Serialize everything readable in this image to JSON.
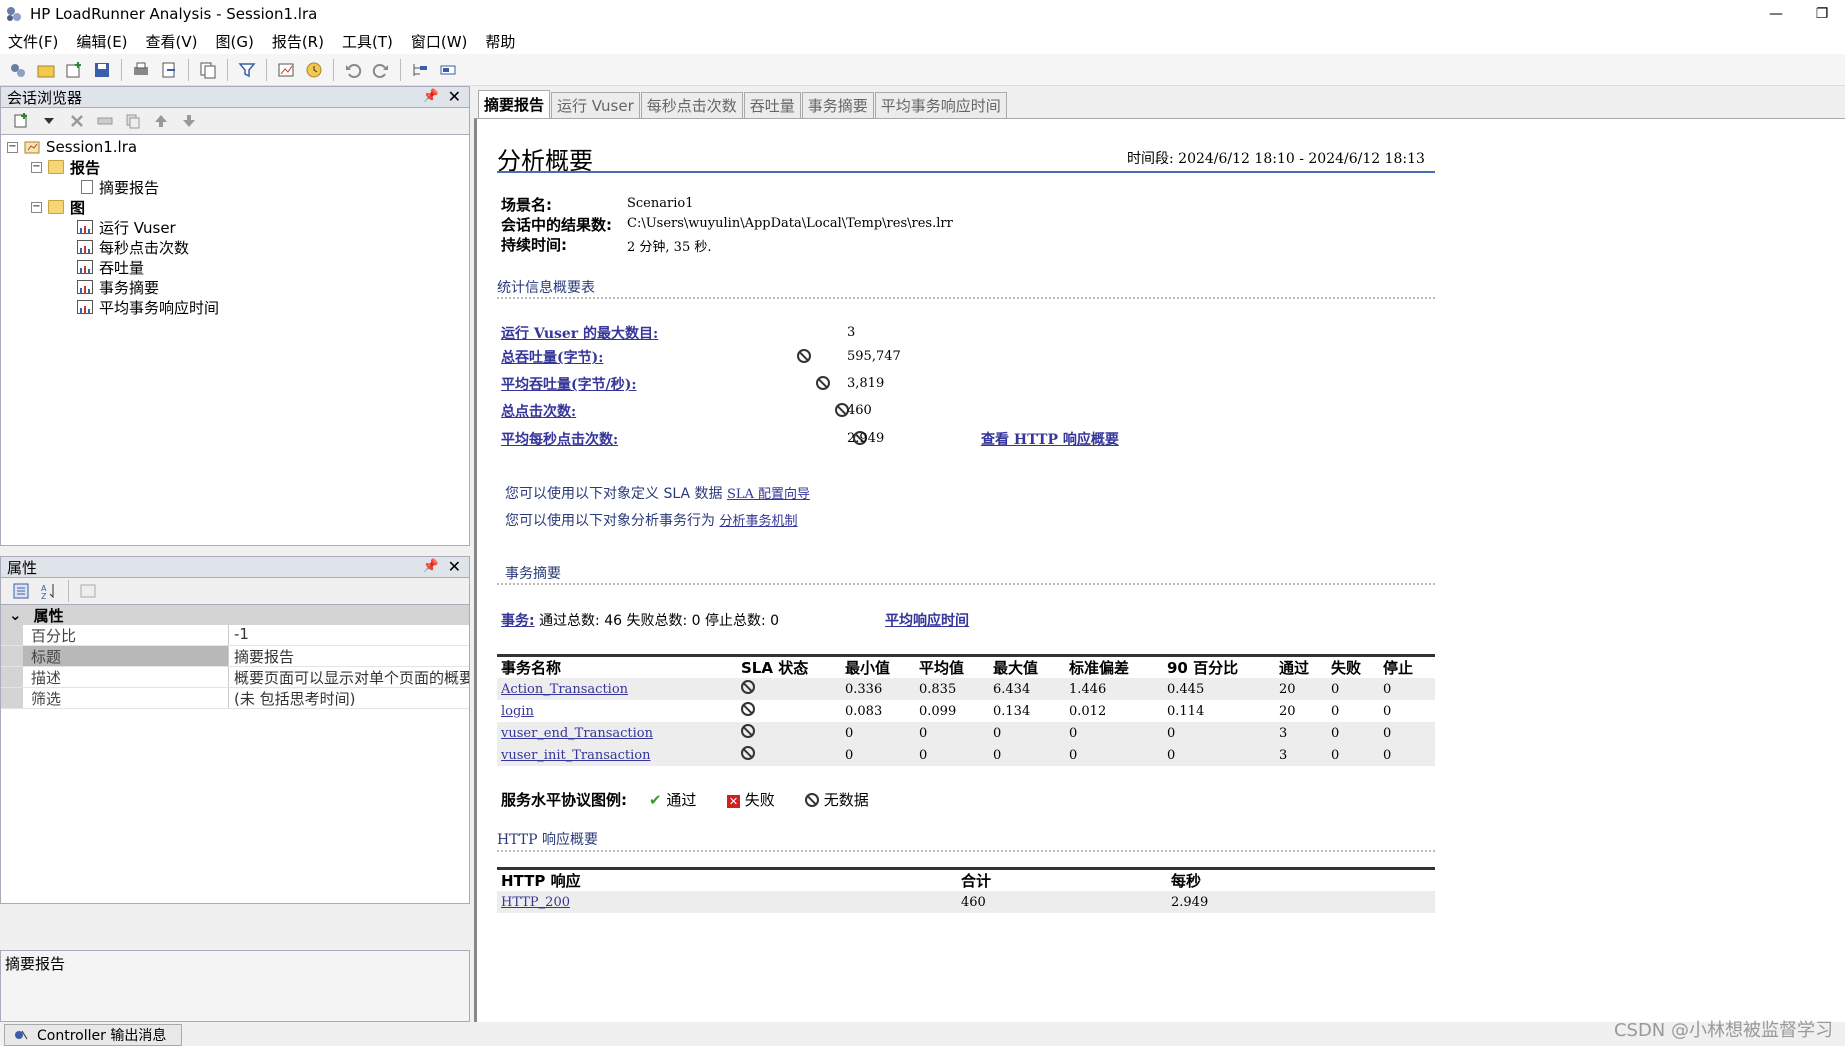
{
  "window": {
    "title": "HP LoadRunner Analysis - Session1.lra"
  },
  "menu": [
    "文件(F)",
    "编辑(E)",
    "查看(V)",
    "图(G)",
    "报告(R)",
    "工具(T)",
    "窗口(W)",
    "帮助"
  ],
  "session_browser": {
    "title": "会话浏览器",
    "tree": {
      "root": "Session1.lra",
      "report_folder": "报告",
      "report_items": [
        "摘要报告"
      ],
      "graph_folder": "图",
      "graph_items": [
        "运行 Vuser",
        "每秒点击次数",
        "吞吐量",
        "事务摘要",
        "平均事务响应时间"
      ]
    }
  },
  "properties": {
    "title": "属性",
    "category": "属性",
    "rows": [
      {
        "key": "百分比",
        "value": "-1"
      },
      {
        "key": "标题",
        "value": "摘要报告"
      },
      {
        "key": "描述",
        "value": "概要页面可以显示对单个页面的概要"
      },
      {
        "key": "筛选",
        "value": "(未 包括思考时间)"
      }
    ],
    "description": "摘要报告"
  },
  "status": {
    "output_tab": "Controller 输出消息"
  },
  "tabs": [
    "摘要报告",
    "运行 Vuser",
    "每秒点击次数",
    "吞吐量",
    "事务摘要",
    "平均事务响应时间"
  ],
  "report": {
    "heading": "分析概要",
    "period_label": "时间段:",
    "period_value": "2024/6/12 18:10 - 2024/6/12 18:13",
    "scenario_label": "场景名:",
    "scenario_value": "Scenario1",
    "results_label": "会话中的结果数:",
    "results_value": "C:\\Users\\wuyulin\\AppData\\Local\\Temp\\res\\res.lrr",
    "duration_label": "持续时间:",
    "duration_value": "2 分钟, 35 秒.",
    "stats_title": "统计信息概要表",
    "stats": [
      {
        "label": "运行 Vuser 的最大数目:",
        "value": "3",
        "icon": false
      },
      {
        "label": "总吞吐量(字节):",
        "value": "595,747",
        "icon": true
      },
      {
        "label": "平均吞吐量(字节/秒):",
        "value": "3,819",
        "icon": true
      },
      {
        "label": "总点击次数:",
        "value": "460",
        "icon": true
      },
      {
        "label": "平均每秒点击次数:",
        "value": "2.949",
        "icon": true
      }
    ],
    "http_summary_link": "查看 HTTP 响应概要",
    "sla_text": "您可以使用以下对象定义 SLA 数据",
    "sla_link": "SLA 配置向导",
    "analyze_text": "您可以使用以下对象分析事务行为",
    "analyze_link": "分析事务机制",
    "trans_title": "事务摘要",
    "trans_label": "事务:",
    "trans_counts": "通过总数: 46 失败总数: 0 停止总数: 0",
    "avg_resp_link": "平均响应时间",
    "trans_headers": [
      "事务名称",
      "SLA 状态",
      "最小值",
      "平均值",
      "最大值",
      "标准偏差",
      "90 百分比",
      "通过",
      "失败",
      "停止"
    ],
    "trans_rows": [
      [
        "Action_Transaction",
        "",
        "0.336",
        "0.835",
        "6.434",
        "1.446",
        "0.445",
        "20",
        "0",
        "0"
      ],
      [
        "login",
        "",
        "0.083",
        "0.099",
        "0.134",
        "0.012",
        "0.114",
        "20",
        "0",
        "0"
      ],
      [
        "vuser_end_Transaction",
        "",
        "0",
        "0",
        "0",
        "0",
        "0",
        "3",
        "0",
        "0"
      ],
      [
        "vuser_init_Transaction",
        "",
        "0",
        "0",
        "0",
        "0",
        "0",
        "3",
        "0",
        "0"
      ]
    ],
    "legend_label": "服务水平协议图例:",
    "legend_pass": "通过",
    "legend_fail": "失败",
    "legend_nodata": "无数据",
    "http_title": "HTTP 响应概要",
    "http_headers": [
      "HTTP 响应",
      "合计",
      "每秒"
    ],
    "http_rows": [
      [
        "HTTP_200",
        "460",
        "2.949"
      ]
    ]
  },
  "watermark": "CSDN @小林想被监督学习"
}
